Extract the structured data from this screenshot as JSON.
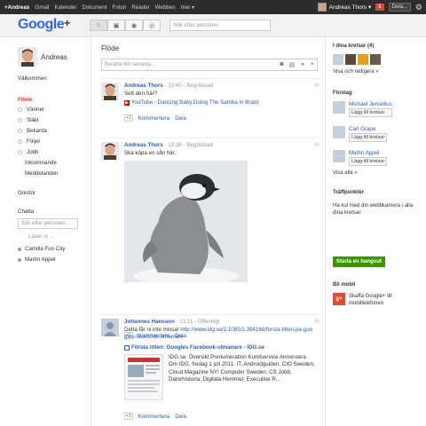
{
  "topbar": {
    "nav": [
      "+Andreas",
      "Gmail",
      "Kalender",
      "Dokument",
      "Foton",
      "Reader",
      "Webben",
      "mer ▾"
    ],
    "user_name": "Andreas Thors ▾",
    "notifications": "1",
    "share_label": "Dela...",
    "settings_icon": "gear-icon"
  },
  "header": {
    "logo": "Google",
    "logo_plus": "+",
    "tabs": [
      {
        "icon": "home-icon",
        "glyph": "⌂"
      },
      {
        "icon": "photos-icon",
        "glyph": "▣"
      },
      {
        "icon": "profile-icon",
        "glyph": "◉"
      },
      {
        "icon": "circles-icon",
        "glyph": "◎"
      }
    ],
    "search_placeholder": "Sök efter personer"
  },
  "left": {
    "profile_name": "Andreas",
    "welcome": "Välkommen",
    "stream": "Flöde",
    "circles": [
      "Vänner",
      "Släkt",
      "Bekanta",
      "Följer",
      "Jobb"
    ],
    "sub_streams": [
      "Inkommande",
      "Meddelanden"
    ],
    "sparks": "Gnistor",
    "chat_title": "Chatta",
    "chat_search_placeholder": "Sök efter personer...",
    "chat_status": "Läser in ...",
    "contacts": [
      "Camilla Fun City",
      "Martin Appel"
    ]
  },
  "center": {
    "title": "Flöde",
    "share_placeholder": "Berätta det senaste...",
    "posts": [
      {
        "author": "Andreas Thors",
        "time": "13:40",
        "visibility": "Begränsad",
        "text": "Sett den här?",
        "link": "YouTube - Dancing Baby Doing The Samba In Brazil",
        "plus_label": "+1",
        "comment": "Kommentera",
        "share": "Dela"
      },
      {
        "author": "Andreas Thors",
        "time": "13:38",
        "visibility": "Begränsad",
        "text": "Ska köpa en sån här.",
        "plus_label": "+1",
        "comment": "Kommentera",
        "share": "Dela"
      },
      {
        "author": "Johannes Hansson",
        "time": "13:11",
        "visibility": "Offentligt",
        "text_prefix": "Detta får ni inte missa! ",
        "text_url": "http://www.idg.se/2.1085/1.394168/forsta-titten-pa-googles-facebook-utmanare",
        "link_title": "Första titten: Googles Facebook-utmanare - IDG.se",
        "snippet": "IDG.se. Översikt Prenumeration Kundservice Annonsera Om IDG. fredag 1 juli 2011. IT, Androidguiden; CIO Sweden; Cloud Magazine NY! Computer Sweden; CS Jobb; Datorhistoria; Digitala Hemmet; Executive R...",
        "plus_label": "+1",
        "comment": "Kommentera",
        "share": "Dela"
      }
    ]
  },
  "right": {
    "circles_title": "I dina kretsar (4)",
    "view_edit": "Visa och redigera »",
    "suggestions_title": "Förslag",
    "suggestions": [
      {
        "name": "Michael Jenselius",
        "button": "Lägg till kretsar"
      },
      {
        "name": "Carl Grape",
        "button": "Lägg till kretsar"
      },
      {
        "name": "Martin Appel",
        "button": "Lägg till kretsar"
      }
    ],
    "show_all": "Visa alla »",
    "hangouts_title": "Träffpunkter",
    "hangouts_text": "Ha kul med din webbkamera i alla dina kretsar.",
    "hangout_button": "Starta en hangout",
    "mobile_title": "Bli mobil",
    "mobile_link": "Skaffa Google+ till mobiltelefonen"
  },
  "colors": {
    "topbar": "#2d2d2d",
    "link": "#2a5db0",
    "accent_red": "#d14836",
    "hangout_green": "#3d9400"
  }
}
